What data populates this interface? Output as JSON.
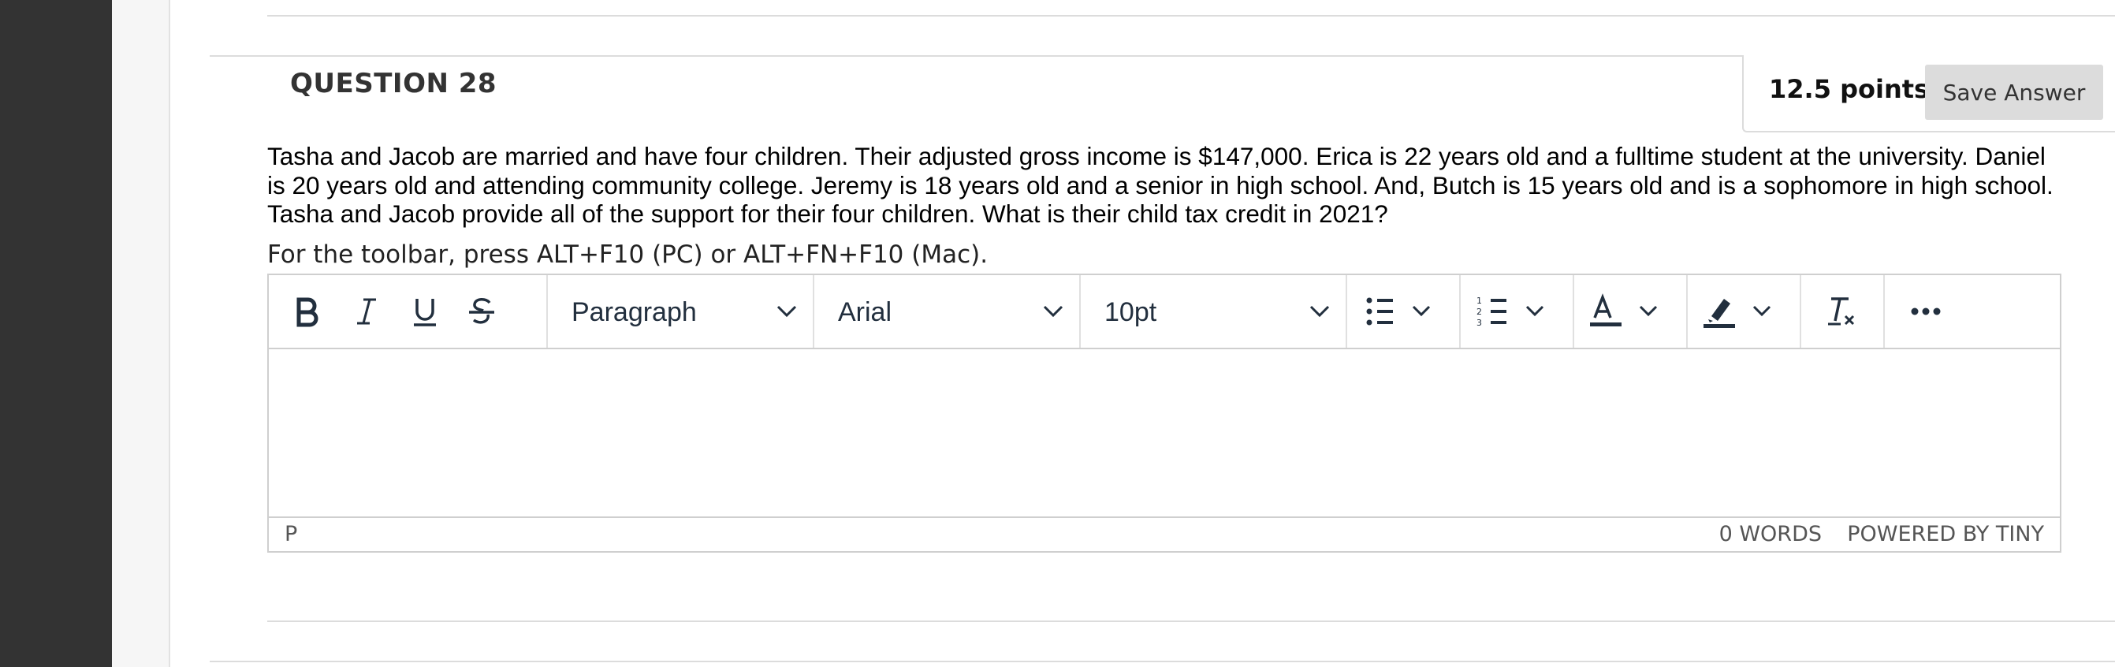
{
  "question": {
    "title": "QUESTION 28",
    "points": "12.5 points",
    "save_label": "Save Answer",
    "text": "Tasha and Jacob are married and have four children. Their adjusted gross income is $147,000. Erica is 22 years old and a fulltime student at the university. Daniel is 20 years old and attending community college. Jeremy is 18 years old and a senior in high school. And, Butch is 15 years old and is a sophomore in high school. Tasha and Jacob provide all of the support for their four children. What is their child tax credit in 2021?"
  },
  "editor": {
    "toolbar_hint": "For the toolbar, press ALT+F10 (PC) or ALT+FN+F10 (Mac).",
    "block_format": "Paragraph",
    "font_family": "Arial",
    "font_size": "10pt",
    "status_path": "P",
    "word_count": "0 WORDS",
    "powered_by": "POWERED BY TINY",
    "icons": [
      "bold-icon",
      "italic-icon",
      "underline-icon",
      "strikethrough-icon",
      "bullet-list-icon",
      "numbered-list-icon",
      "text-color-icon",
      "highlight-icon",
      "clear-formatting-icon",
      "more-icon"
    ]
  },
  "colors": {
    "sidebar": "#333333",
    "toolbar_icon": "#222f3e",
    "save_button": "#dcdcdc"
  }
}
